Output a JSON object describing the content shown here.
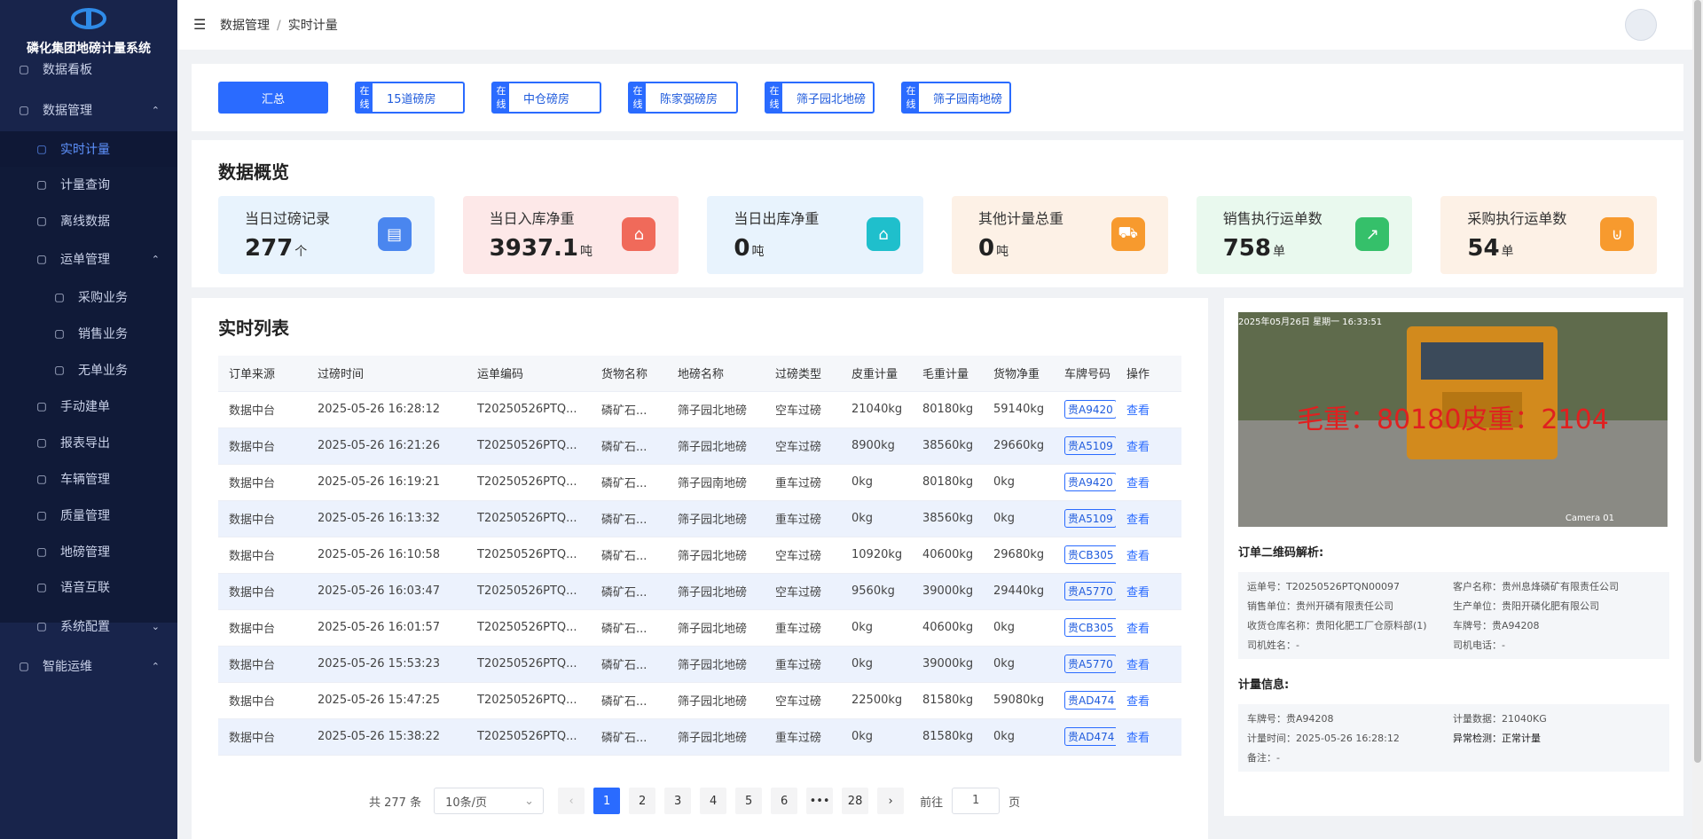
{
  "app": {
    "title": "磷化集团地磅计量系统"
  },
  "sidebar": {
    "items": [
      {
        "label": "数据看板",
        "icon": "dashboard-icon"
      },
      {
        "label": "数据管理",
        "icon": "chart-icon"
      },
      {
        "label": "实时计量",
        "icon": "monitor-icon"
      },
      {
        "label": "计量查询",
        "icon": "query-icon"
      },
      {
        "label": "离线数据",
        "icon": "offline-icon"
      },
      {
        "label": "运单管理",
        "icon": "document-icon"
      },
      {
        "label": "采购业务",
        "icon": "purchase-icon"
      },
      {
        "label": "销售业务",
        "icon": "sales-icon"
      },
      {
        "label": "无单业务",
        "icon": "no-order-icon"
      },
      {
        "label": "手动建单",
        "icon": "manual-icon"
      },
      {
        "label": "报表导出",
        "icon": "export-icon"
      },
      {
        "label": "车辆管理",
        "icon": "truck-icon"
      },
      {
        "label": "质量管理",
        "icon": "shield-icon"
      },
      {
        "label": "地磅管理",
        "icon": "scale-icon"
      },
      {
        "label": "语音互联",
        "icon": "speaker-icon"
      },
      {
        "label": "系统配置",
        "icon": "gear-icon"
      },
      {
        "label": "智能运维",
        "icon": "ops-icon"
      }
    ]
  },
  "header": {
    "breadcrumb_parent": "数据管理",
    "breadcrumb_current": "实时计量"
  },
  "tabs": {
    "summary": "汇总",
    "badge": "在线",
    "stations": [
      "15道磅房",
      "中仓磅房",
      "陈家弼磅房",
      "筛子园北地磅",
      "筛子园南地磅"
    ]
  },
  "overview": {
    "title": "数据概览",
    "cards": [
      {
        "label": "当日过磅记录",
        "value": "277",
        "unit": "个",
        "bg": "#e8f3fd",
        "icon_color": "#4a86ef",
        "icon": "trend-chart-icon"
      },
      {
        "label": "当日入库净重",
        "value": "3937.1",
        "unit": "吨",
        "bg": "#fde8e8",
        "icon_color": "#f06a5a",
        "icon": "warehouse-in-icon"
      },
      {
        "label": "当日出库净重",
        "value": "0",
        "unit": "吨",
        "bg": "#e8f3fd",
        "icon_color": "#1fbfcc",
        "icon": "warehouse-out-icon"
      },
      {
        "label": "其他计量总重",
        "value": "0",
        "unit": "吨",
        "bg": "#fdf1e6",
        "icon_color": "#f79a2e",
        "icon": "truck-icon"
      },
      {
        "label": "销售执行运单数",
        "value": "758",
        "unit": "单",
        "bg": "#e9f9ee",
        "icon_color": "#35c06a",
        "icon": "line-chart-icon"
      },
      {
        "label": "采购执行运单数",
        "value": "54",
        "unit": "单",
        "bg": "#fdf1e6",
        "icon_color": "#f79a2e",
        "icon": "cart-icon"
      }
    ]
  },
  "list": {
    "title": "实时列表",
    "headers": [
      "订单来源",
      "过磅时间",
      "运单编码",
      "货物名称",
      "地磅名称",
      "过磅类型",
      "皮重计量",
      "毛重计量",
      "货物净重",
      "车牌号码",
      "操作"
    ],
    "rows": [
      [
        "数据中台",
        "2025-05-26 16:28:12",
        "T20250526PTQ...",
        "磷矿石...",
        "筛子园北地磅",
        "空车过磅",
        "21040kg",
        "80180kg",
        "59140kg",
        "贵A9420",
        "查看"
      ],
      [
        "数据中台",
        "2025-05-26 16:21:26",
        "T20250526PTQ...",
        "磷矿石...",
        "筛子园北地磅",
        "空车过磅",
        "8900kg",
        "38560kg",
        "29660kg",
        "贵A5109",
        "查看"
      ],
      [
        "数据中台",
        "2025-05-26 16:19:21",
        "T20250526PTQ...",
        "磷矿石...",
        "筛子园南地磅",
        "重车过磅",
        "0kg",
        "80180kg",
        "0kg",
        "贵A9420",
        "查看"
      ],
      [
        "数据中台",
        "2025-05-26 16:13:32",
        "T20250526PTQ...",
        "磷矿石...",
        "筛子园北地磅",
        "重车过磅",
        "0kg",
        "38560kg",
        "0kg",
        "贵A5109",
        "查看"
      ],
      [
        "数据中台",
        "2025-05-26 16:10:58",
        "T20250526PTQ...",
        "磷矿石...",
        "筛子园北地磅",
        "空车过磅",
        "10920kg",
        "40600kg",
        "29680kg",
        "贵CB305",
        "查看"
      ],
      [
        "数据中台",
        "2025-05-26 16:03:47",
        "T20250526PTQ...",
        "磷矿石...",
        "筛子园北地磅",
        "空车过磅",
        "9560kg",
        "39000kg",
        "29440kg",
        "贵A5770",
        "查看"
      ],
      [
        "数据中台",
        "2025-05-26 16:01:57",
        "T20250526PTQ...",
        "磷矿石...",
        "筛子园北地磅",
        "重车过磅",
        "0kg",
        "40600kg",
        "0kg",
        "贵CB305",
        "查看"
      ],
      [
        "数据中台",
        "2025-05-26 15:53:23",
        "T20250526PTQ...",
        "磷矿石...",
        "筛子园北地磅",
        "重车过磅",
        "0kg",
        "39000kg",
        "0kg",
        "贵A5770",
        "查看"
      ],
      [
        "数据中台",
        "2025-05-26 15:47:25",
        "T20250526PTQ...",
        "磷矿石...",
        "筛子园北地磅",
        "空车过磅",
        "22500kg",
        "81580kg",
        "59080kg",
        "贵AD474",
        "查看"
      ],
      [
        "数据中台",
        "2025-05-26 15:38:22",
        "T20250526PTQ...",
        "磷矿石...",
        "筛子园北地磅",
        "重车过磅",
        "0kg",
        "81580kg",
        "0kg",
        "贵AD474",
        "查看"
      ]
    ]
  },
  "pager": {
    "total": "共 277 条",
    "page_size": "10条/页",
    "pages": [
      "1",
      "2",
      "3",
      "4",
      "5",
      "6",
      "•••",
      "28"
    ],
    "current": "1",
    "goto_prefix": "前往",
    "goto_value": "1",
    "goto_suffix": "页"
  },
  "detail": {
    "camera_osd": "2025年05月26日 星期一 16:33:51",
    "camera_overlay": "毛重：80180皮重：2104",
    "camera_label": "Camera 01",
    "qr_title": "订单二维码解析:",
    "qr": [
      [
        "运单号：T20250526PTQN00097",
        "客户名称：贵州息烽磷矿有限责任公司"
      ],
      [
        "销售单位：贵州开磷有限责任公司",
        "生产单位：贵阳开磷化肥有限公司"
      ],
      [
        "收货仓库名称：贵阳化肥工厂仓原料部(1)",
        "车牌号：贵A94208"
      ],
      [
        "司机姓名：-",
        "司机电话：-"
      ]
    ],
    "measure_title": "计量信息:",
    "measure": [
      [
        "车牌号：贵A94208",
        "计量数据：21040KG"
      ],
      [
        "计量时间：2025-05-26 16:28:12",
        "异常检测：正常计量"
      ],
      [
        "备注：-",
        ""
      ]
    ]
  }
}
